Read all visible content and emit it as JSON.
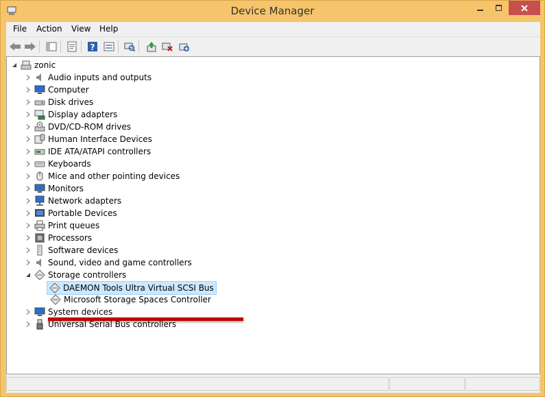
{
  "window": {
    "title": "Device Manager"
  },
  "menu": {
    "items": [
      "File",
      "Action",
      "View",
      "Help"
    ]
  },
  "toolbar": {
    "buttons": [
      "back-icon",
      "forward-icon",
      "show-hide-console-tree-icon",
      "properties-icon",
      "help-icon",
      "view-icon",
      "scan-hardware-icon",
      "update-driver-icon",
      "uninstall-icon",
      "add-legacy-icon"
    ]
  },
  "tree": {
    "root": "zonic",
    "categories": [
      "Audio inputs and outputs",
      "Computer",
      "Disk drives",
      "Display adapters",
      "DVD/CD-ROM drives",
      "Human Interface Devices",
      "IDE ATA/ATAPI controllers",
      "Keyboards",
      "Mice and other pointing devices",
      "Monitors",
      "Network adapters",
      "Portable Devices",
      "Print queues",
      "Processors",
      "Software devices",
      "Sound, video and game controllers",
      "Storage controllers"
    ],
    "storage_children": [
      "DAEMON Tools Ultra Virtual SCSI Bus",
      "Microsoft Storage Spaces Controller"
    ],
    "after": [
      "System devices",
      "Universal Serial Bus controllers"
    ]
  },
  "colors": {
    "title_bar": "#f5c46b",
    "close_button": "#c7504f",
    "selection": "#cce8ff",
    "highlight_bar": "#c00000"
  }
}
